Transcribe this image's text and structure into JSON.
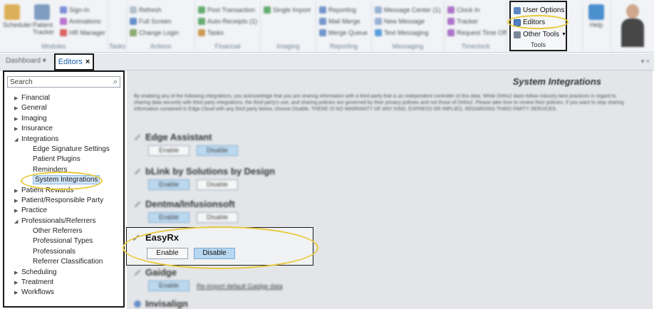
{
  "ribbon": {
    "groups": [
      {
        "label": "Modules",
        "items": [
          "Scheduler",
          "Patient Tracker",
          "Sign-In",
          "Animations",
          "HR Manager"
        ]
      },
      {
        "label": "Tasks",
        "items": []
      },
      {
        "label": "Actions",
        "items": [
          "Refresh",
          "Full Screen",
          "Change Login"
        ]
      },
      {
        "label": "Financial",
        "items": [
          "Post Transaction",
          "Auto-Receipts (1)",
          "Tasks"
        ]
      },
      {
        "label": "Imaging",
        "items": [
          "Single Import"
        ]
      },
      {
        "label": "Reporting",
        "items": [
          "Reporting",
          "Mail Merge",
          "Merge Queue"
        ]
      },
      {
        "label": "Messaging",
        "items": [
          "Message Center (1)",
          "New Message",
          "Text Messaging"
        ]
      },
      {
        "label": "Timeclock",
        "items": [
          "Clock In",
          "Tracker",
          "Request Time Off"
        ]
      }
    ],
    "tools": {
      "label": "Tools",
      "user_options": "User Options",
      "editors": "Editors",
      "other_tools": "Other Tools"
    },
    "help": "Help",
    "accent": "#1c5fa8",
    "highlight": "#e8c93a"
  },
  "tabs": {
    "dashboard": "Dashboard",
    "editors": "Editors",
    "close": "×"
  },
  "tree": {
    "search_placeholder": "Search",
    "nodes": [
      {
        "label": "Financial",
        "level": 0,
        "arrow": "▶"
      },
      {
        "label": "General",
        "level": 0,
        "arrow": "▶"
      },
      {
        "label": "Imaging",
        "level": 0,
        "arrow": "▶"
      },
      {
        "label": "Insurance",
        "level": 0,
        "arrow": "▶"
      },
      {
        "label": "Integrations",
        "level": 0,
        "arrow": "◢"
      },
      {
        "label": "Edge Signature Settings",
        "level": 1
      },
      {
        "label": "Patient Plugins",
        "level": 1
      },
      {
        "label": "Reminders",
        "level": 1
      },
      {
        "label": "System Integrations",
        "level": 1,
        "selected": true
      },
      {
        "label": "Patient Rewards",
        "level": 0,
        "arrow": "▶"
      },
      {
        "label": "Patient/Responsible Party",
        "level": 0,
        "arrow": "▶"
      },
      {
        "label": "Practice",
        "level": 0,
        "arrow": "▶"
      },
      {
        "label": "Professionals/Referrers",
        "level": 0,
        "arrow": "◢"
      },
      {
        "label": "Other Referrers",
        "level": 1
      },
      {
        "label": "Professional Types",
        "level": 1
      },
      {
        "label": "Professionals",
        "level": 1
      },
      {
        "label": "Referrer Classification",
        "level": 1
      },
      {
        "label": "Scheduling",
        "level": 0,
        "arrow": "▶"
      },
      {
        "label": "Treatment",
        "level": 0,
        "arrow": "▶"
      },
      {
        "label": "Workflows",
        "level": 0,
        "arrow": "▶"
      }
    ]
  },
  "content": {
    "title": "System Integrations",
    "disclaimer": "By enabling any of the following integrations, you acknowledge that you are sharing information with a third party that is an independent controller of this data. While Ortho2 does follow industry best practices in regard to sharing data securely with third party integrations, the third party's use, and sharing policies are governed by their privacy policies and not those of Ortho2. Please take time to review their policies. If you want to stop sharing information contained in Edge Cloud with any third party below, choose Disable. THERE IS NO WARRANTY OF ANY KIND, EXPRESS OR IMPLIED, REGARDING THIRD PARTY SERVICES.",
    "enable": "Enable",
    "disable": "Disable",
    "sections": [
      {
        "name": "Edge Assistant",
        "active": "disable"
      },
      {
        "name": "bLink by Solutions by Design",
        "active": "enable"
      },
      {
        "name": "Dentma/Infusionsoft",
        "active": "enable"
      },
      {
        "name": "EasyRx",
        "active": "disable"
      },
      {
        "name": "Gaidge",
        "active": "enable",
        "extra_link": "Re-import default Gaidge data"
      },
      {
        "name": "Invisalign",
        "active": "none"
      }
    ]
  }
}
